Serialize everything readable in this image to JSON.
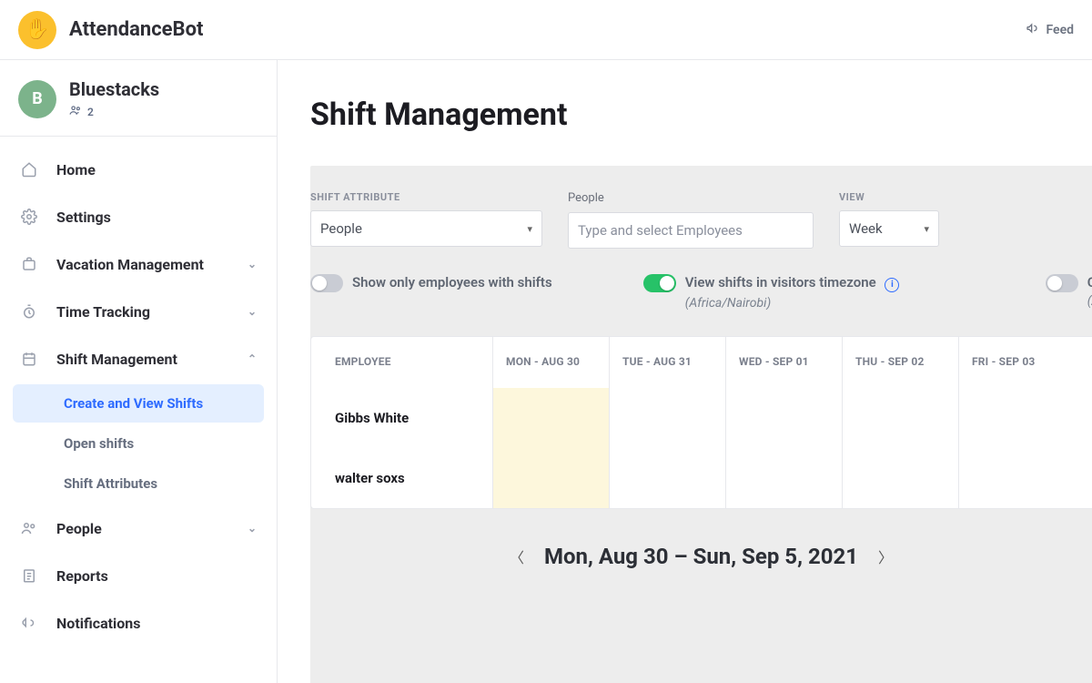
{
  "brand": {
    "name": "AttendanceBot",
    "logo_emoji": "✋"
  },
  "topbar": {
    "feedback_label": "Feed"
  },
  "org": {
    "avatar_letter": "B",
    "name": "Bluestacks",
    "member_count": "2"
  },
  "nav": {
    "home": "Home",
    "settings": "Settings",
    "vacation": "Vacation Management",
    "time_tracking": "Time Tracking",
    "shift_mgmt": "Shift Management",
    "people": "People",
    "reports": "Reports",
    "notifications": "Notifications"
  },
  "shift_sub": {
    "create_view": "Create and View Shifts",
    "open_shifts": "Open shifts",
    "attributes": "Shift Attributes"
  },
  "page": {
    "title": "Shift Management"
  },
  "filters": {
    "attribute_label": "SHIFT ATTRIBUTE",
    "attribute_value": "People",
    "people_label": "People",
    "people_placeholder": "Type and select Employees",
    "view_label": "VIEW",
    "view_value": "Week"
  },
  "toggles": {
    "show_only": "Show only employees with shifts",
    "visitor_tz": "View shifts in visitors timezone",
    "visitor_tz_detail": "(Africa/Nairobi)",
    "create_partial": "Cr",
    "create_partial_sub": "(A"
  },
  "schedule": {
    "employee_header": "EMPLOYEE",
    "days": [
      "MON - AUG 30",
      "TUE - AUG 31",
      "WED - SEP 01",
      "THU - SEP 02",
      "FRI - SEP 03"
    ],
    "employees": [
      "Gibbs White",
      "walter soxs"
    ]
  },
  "daterange": "Mon, Aug 30 – Sun, Sep 5, 2021"
}
